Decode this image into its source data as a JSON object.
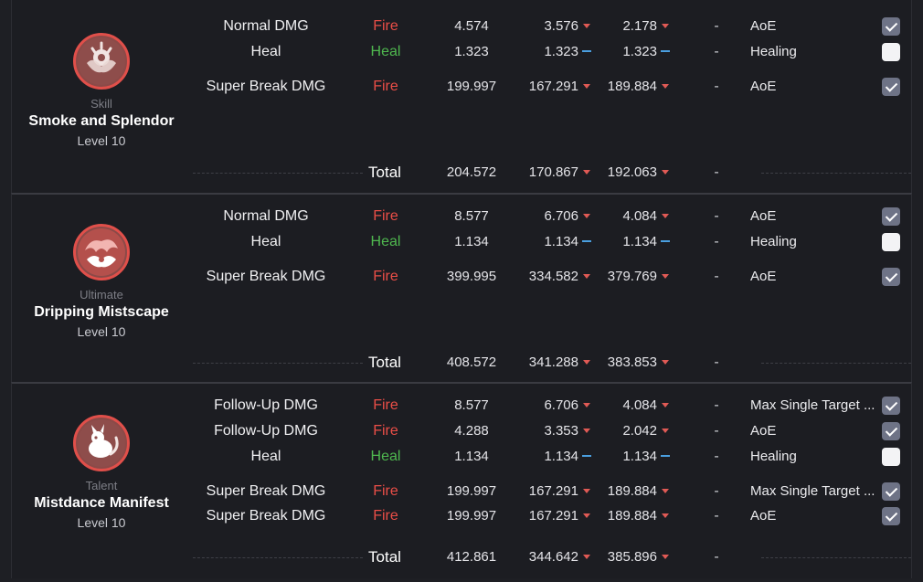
{
  "sections": [
    {
      "type": "Skill",
      "name": "Smoke and Splendor",
      "level": "Level 10",
      "rows": [
        {
          "name": "Normal DMG",
          "element": "Fire",
          "v1": "4.574",
          "v2": "3.576",
          "v2_trend": "down",
          "v3": "2.178",
          "v3_trend": "down",
          "extra": "-",
          "target": "AoE",
          "checked": true
        },
        {
          "name": "Heal",
          "element": "Heal",
          "v1": "1.323",
          "v2": "1.323",
          "v2_trend": "flat",
          "v3": "1.323",
          "v3_trend": "flat",
          "extra": "-",
          "target": "Healing",
          "checked": false
        },
        {
          "name": "Super Break DMG",
          "element": "Fire",
          "v1": "199.997",
          "v2": "167.291",
          "v2_trend": "down",
          "v3": "189.884",
          "v3_trend": "down",
          "extra": "-",
          "target": "AoE",
          "checked": true
        }
      ],
      "total": {
        "label": "Total",
        "v1": "204.572",
        "v2": "170.867",
        "v2_trend": "down",
        "v3": "192.063",
        "v3_trend": "down",
        "extra": "-"
      }
    },
    {
      "type": "Ultimate",
      "name": "Dripping Mistscape",
      "level": "Level 10",
      "rows": [
        {
          "name": "Normal DMG",
          "element": "Fire",
          "v1": "8.577",
          "v2": "6.706",
          "v2_trend": "down",
          "v3": "4.084",
          "v3_trend": "down",
          "extra": "-",
          "target": "AoE",
          "checked": true
        },
        {
          "name": "Heal",
          "element": "Heal",
          "v1": "1.134",
          "v2": "1.134",
          "v2_trend": "flat",
          "v3": "1.134",
          "v3_trend": "flat",
          "extra": "-",
          "target": "Healing",
          "checked": false
        },
        {
          "name": "Super Break DMG",
          "element": "Fire",
          "v1": "399.995",
          "v2": "334.582",
          "v2_trend": "down",
          "v3": "379.769",
          "v3_trend": "down",
          "extra": "-",
          "target": "AoE",
          "checked": true
        }
      ],
      "total": {
        "label": "Total",
        "v1": "408.572",
        "v2": "341.288",
        "v2_trend": "down",
        "v3": "383.853",
        "v3_trend": "down",
        "extra": "-"
      }
    },
    {
      "type": "Talent",
      "name": "Mistdance Manifest",
      "level": "Level 10",
      "rows": [
        {
          "name": "Follow-Up DMG",
          "element": "Fire",
          "v1": "8.577",
          "v2": "6.706",
          "v2_trend": "down",
          "v3": "4.084",
          "v3_trend": "down",
          "extra": "-",
          "target": "Max Single Target ...",
          "checked": true
        },
        {
          "name": "Follow-Up DMG",
          "element": "Fire",
          "v1": "4.288",
          "v2": "3.353",
          "v2_trend": "down",
          "v3": "2.042",
          "v3_trend": "down",
          "extra": "-",
          "target": "AoE",
          "checked": true
        },
        {
          "name": "Heal",
          "element": "Heal",
          "v1": "1.134",
          "v2": "1.134",
          "v2_trend": "flat",
          "v3": "1.134",
          "v3_trend": "flat",
          "extra": "-",
          "target": "Healing",
          "checked": false
        },
        {
          "name": "Super Break DMG",
          "element": "Fire",
          "v1": "199.997",
          "v2": "167.291",
          "v2_trend": "down",
          "v3": "189.884",
          "v3_trend": "down",
          "extra": "-",
          "target": "Max Single Target ...",
          "checked": true
        },
        {
          "name": "Super Break DMG",
          "element": "Fire",
          "v1": "199.997",
          "v2": "167.291",
          "v2_trend": "down",
          "v3": "189.884",
          "v3_trend": "down",
          "extra": "-",
          "target": "AoE",
          "checked": true
        }
      ],
      "total": {
        "label": "Total",
        "v1": "412.861",
        "v2": "344.642",
        "v2_trend": "down",
        "v3": "385.896",
        "v3_trend": "down",
        "extra": "-"
      }
    }
  ],
  "colors": {
    "fire": "#ea4e47",
    "heal": "#4fb84f",
    "trend_down": "#e05a55",
    "trend_flat": "#4a9fe0",
    "icon_ring": "#e04f4a"
  },
  "icons": [
    "skill-emblem-icon",
    "ultimate-emblem-icon",
    "talent-emblem-icon",
    "trend-down-icon",
    "trend-flat-icon"
  ]
}
